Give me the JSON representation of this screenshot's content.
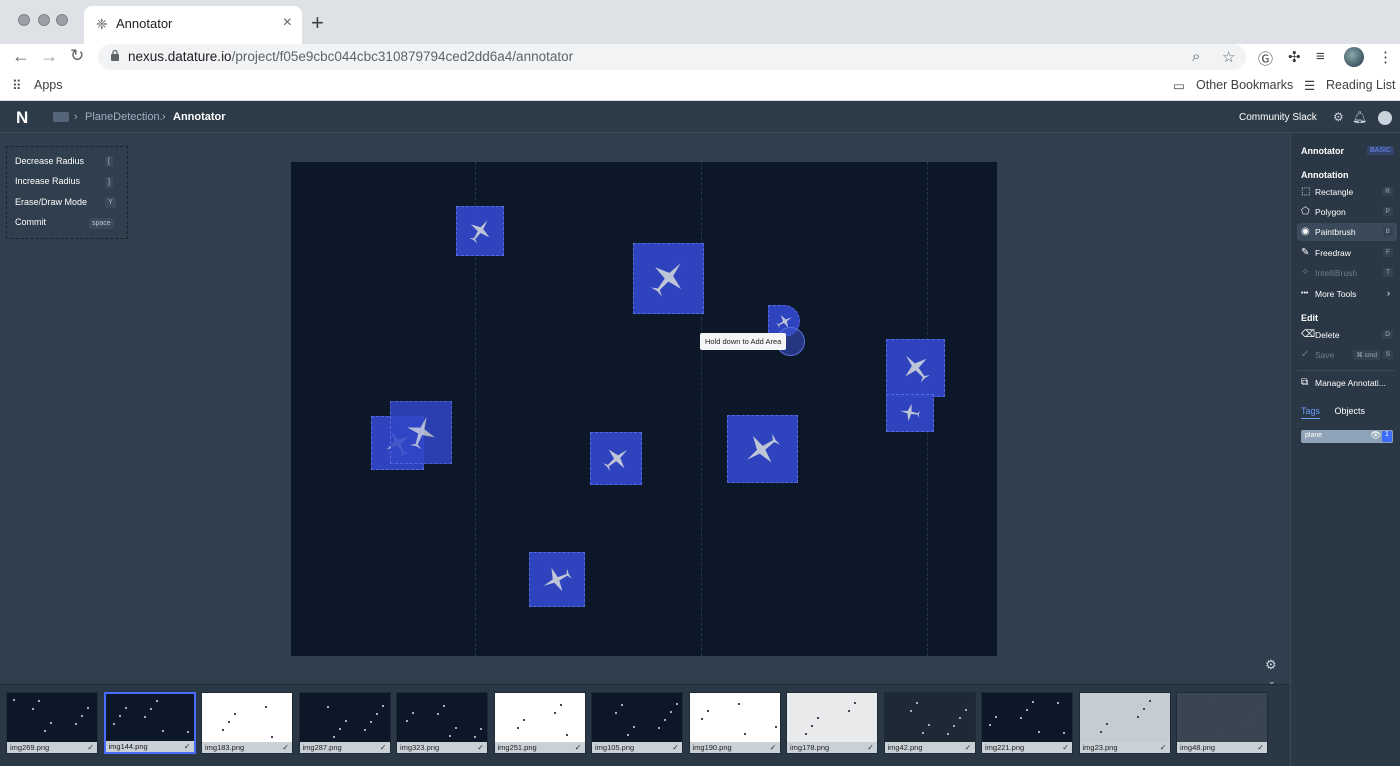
{
  "browser": {
    "tab_title": "Annotator",
    "url_host": "nexus.datature.io",
    "url_path": "/project/f05e9cbc044cbc310879794ced2dd6a4/annotator",
    "bookmarks": {
      "apps": "Apps",
      "other": "Other Bookmarks",
      "reading": "Reading List"
    }
  },
  "header": {
    "logo": "N",
    "crumb_project": "PlaneDetection.",
    "crumb_page": "Annotator",
    "community": "Community Slack"
  },
  "helper": {
    "items": [
      {
        "label": "Decrease Radius",
        "key": "["
      },
      {
        "label": "Increase Radius",
        "key": "]"
      },
      {
        "label": "Erase/Draw Mode",
        "key": "Y"
      },
      {
        "label": "Commit",
        "key": "space"
      }
    ]
  },
  "canvas": {
    "tooltip": "Hold down to Add Area"
  },
  "panel": {
    "title": "Annotator",
    "mode_badge": "BASIC",
    "annotation_heading": "Annotation",
    "tools": [
      {
        "label": "Rectangle",
        "key": "R",
        "icon": "⬚"
      },
      {
        "label": "Polygon",
        "key": "P",
        "icon": "⬠"
      },
      {
        "label": "Paintbrush",
        "key": "B",
        "icon": "◉"
      },
      {
        "label": "Freedraw",
        "key": "F",
        "icon": "✎"
      },
      {
        "label": "IntelliBrush",
        "key": "T",
        "icon": "✧"
      },
      {
        "label": "More Tools",
        "key": "›",
        "icon": "•••"
      }
    ],
    "edit_heading": "Edit",
    "delete": {
      "label": "Delete",
      "key": "D",
      "icon": "⌫"
    },
    "save": {
      "label": "Save",
      "cmd": "⌘ cmd",
      "key": "S",
      "icon": "✓"
    },
    "manage": "Manage Annotati...",
    "tab_tags": "Tags",
    "tab_objects": "Objects",
    "tag_name": "plane",
    "tag_count": "1"
  },
  "thumbnails": [
    {
      "name": "img269.png",
      "bg": "#0c1828"
    },
    {
      "name": "img144.png",
      "bg": "#0c1828"
    },
    {
      "name": "img183.png",
      "bg": "#ffffff"
    },
    {
      "name": "img287.png",
      "bg": "#0c1828"
    },
    {
      "name": "img323.png",
      "bg": "#0c1828"
    },
    {
      "name": "img251.png",
      "bg": "#ffffff"
    },
    {
      "name": "img105.png",
      "bg": "#0c1828"
    },
    {
      "name": "img190.png",
      "bg": "#ffffff"
    },
    {
      "name": "img178.png",
      "bg": "#e8eaec"
    },
    {
      "name": "img42.png",
      "bg": "#1d2a36"
    },
    {
      "name": "img221.png",
      "bg": "#0c1828"
    },
    {
      "name": "img23.png",
      "bg": "#c5ccd2"
    },
    {
      "name": "img48.png",
      "bg": "#3a4552"
    }
  ]
}
